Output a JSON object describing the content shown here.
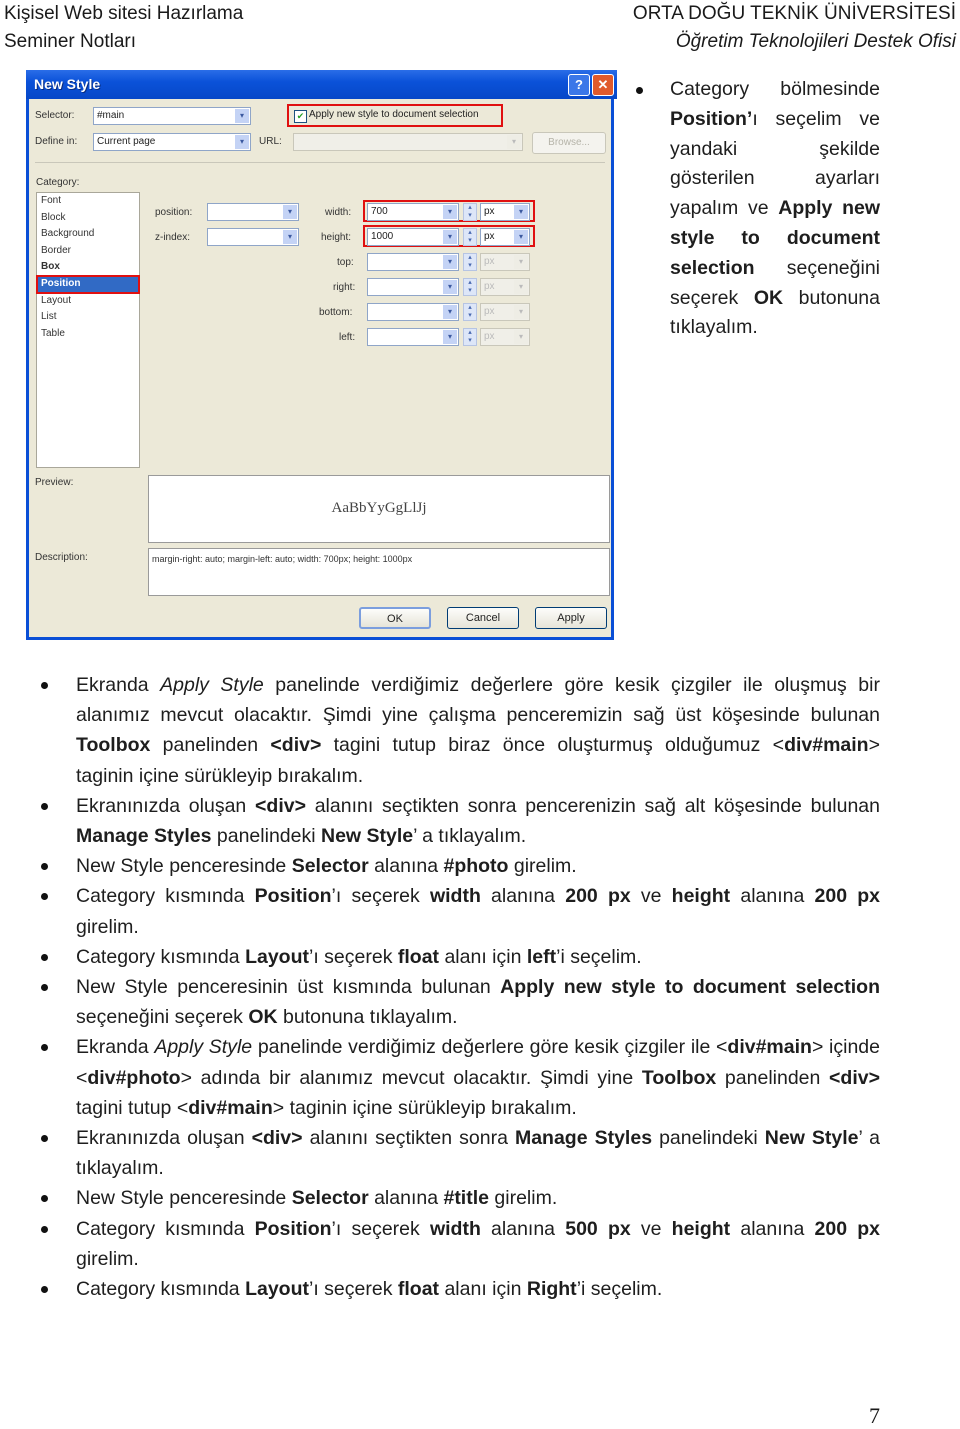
{
  "header": {
    "left_line1": "Kişisel Web sitesi Hazırlama",
    "left_line2": "Seminer Notları",
    "right_line1": "ORTA DOĞU TEKNİK ÜNİVERSİTESİ",
    "right_line2": "Öğretim Teknolojileri Destek Ofisi"
  },
  "dialog": {
    "title": "New Style",
    "help_icon": "?",
    "close_icon": "✕",
    "selector_label": "Selector:",
    "selector_value": "#main",
    "define_in_label": "Define in:",
    "define_in_value": "Current page",
    "url_label": "URL:",
    "url_value": "",
    "apply_checkbox_label": "Apply new style to document selection",
    "apply_checkbox_checked": true,
    "browse_label": "Browse...",
    "category_label": "Category:",
    "categories": [
      {
        "label": "Font",
        "state": "normal"
      },
      {
        "label": "Block",
        "state": "normal"
      },
      {
        "label": "Background",
        "state": "normal"
      },
      {
        "label": "Border",
        "state": "normal"
      },
      {
        "label": "Box",
        "state": "bold"
      },
      {
        "label": "Position",
        "state": "selected"
      },
      {
        "label": "Layout",
        "state": "normal"
      },
      {
        "label": "List",
        "state": "normal"
      },
      {
        "label": "Table",
        "state": "normal"
      }
    ],
    "position_label": "position:",
    "position_value": "",
    "zindex_label": "z-index:",
    "zindex_value": "",
    "width_label": "width:",
    "width_value": "700",
    "width_unit": "px",
    "height_label": "height:",
    "height_value": "1000",
    "height_unit": "px",
    "top_label": "top:",
    "right_label": "right:",
    "bottom_label": "bottom:",
    "left_label": "left:",
    "disabled_unit": "px",
    "preview_label": "Preview:",
    "preview_text": "AaBbYyGgLlJj",
    "description_label": "Description:",
    "description_text": "margin-right: auto; margin-left: auto; width: 700px; height: 1000px",
    "ok_label": "OK",
    "cancel_label": "Cancel",
    "apply_label": "Apply"
  },
  "side_note": {
    "parts": [
      {
        "t": "Category bölmesinde ",
        "b": false
      },
      {
        "t": "Position’",
        "b": true
      },
      {
        "t": "ı seçelim ve yandaki şekilde gösterilen ayarları yapalım ve ",
        "b": false
      },
      {
        "t": "Apply new style to document selection",
        "b": true
      },
      {
        "t": " seçeneğini seçerek ",
        "b": false
      },
      {
        "t": "OK",
        "b": true
      },
      {
        "t": " butonuna tıklayalım.",
        "b": false
      }
    ]
  },
  "bullets": [
    [
      {
        "t": "Ekranda "
      },
      {
        "t": "Apply Style",
        "i": true
      },
      {
        "t": " panelinde verdiğimiz değerlere göre kesik çizgiler ile oluşmuş bir alanımız mevcut olacaktır. Şimdi yine çalışma penceremizin sağ üst köşesinde bulunan "
      },
      {
        "t": "Toolbox",
        "b": true
      },
      {
        "t": " panelinden "
      },
      {
        "t": "<div>",
        "b": true
      },
      {
        "t": " tagini tutup biraz önce oluşturmuş olduğumuz <"
      },
      {
        "t": "div#main",
        "b": true
      },
      {
        "t": "> taginin içine sürükleyip bırakalım."
      }
    ],
    [
      {
        "t": "Ekranınızda oluşan "
      },
      {
        "t": "<div>",
        "b": true
      },
      {
        "t": " alanını seçtikten sonra pencerenizin sağ alt köşesinde bulunan "
      },
      {
        "t": "Manage Styles",
        "b": true
      },
      {
        "t": " panelindeki "
      },
      {
        "t": "New Style",
        "b": true
      },
      {
        "t": "’ a tıklayalım."
      }
    ],
    [
      {
        "t": "New Style penceresinde "
      },
      {
        "t": "Selector",
        "b": true
      },
      {
        "t": " alanına "
      },
      {
        "t": "#photo",
        "b": true
      },
      {
        "t": " girelim."
      }
    ],
    [
      {
        "t": "Category kısmında "
      },
      {
        "t": "Position",
        "b": true
      },
      {
        "t": "’ı seçerek "
      },
      {
        "t": "width",
        "b": true
      },
      {
        "t": " alanına "
      },
      {
        "t": "200 px",
        "b": true
      },
      {
        "t": " ve "
      },
      {
        "t": "height",
        "b": true
      },
      {
        "t": " alanına "
      },
      {
        "t": "200 px",
        "b": true
      },
      {
        "t": " girelim."
      }
    ],
    [
      {
        "t": "Category kısmında "
      },
      {
        "t": "Layout",
        "b": true
      },
      {
        "t": "’ı seçerek "
      },
      {
        "t": "float",
        "b": true
      },
      {
        "t": " alanı için "
      },
      {
        "t": "left",
        "b": true
      },
      {
        "t": "’i seçelim."
      }
    ],
    [
      {
        "t": "New Style penceresinin üst kısmında bulunan "
      },
      {
        "t": "Apply new style to document selection",
        "b": true
      },
      {
        "t": " seçeneğini seçerek "
      },
      {
        "t": "OK",
        "b": true
      },
      {
        "t": " butonuna tıklayalım."
      }
    ],
    [
      {
        "t": "Ekranda "
      },
      {
        "t": "Apply Style",
        "i": true
      },
      {
        "t": " panelinde verdiğimiz değerlere göre kesik çizgiler ile <"
      },
      {
        "t": "div#main",
        "b": true
      },
      {
        "t": "> içinde <"
      },
      {
        "t": "div#photo",
        "b": true
      },
      {
        "t": "> adında bir alanımız mevcut olacaktır. Şimdi yine "
      },
      {
        "t": "Toolbox",
        "b": true
      },
      {
        "t": " panelinden "
      },
      {
        "t": "<div>",
        "b": true
      },
      {
        "t": " tagini tutup <"
      },
      {
        "t": "div#main",
        "b": true
      },
      {
        "t": "> taginin içine sürükleyip bırakalım."
      }
    ],
    [
      {
        "t": "Ekranınızda oluşan "
      },
      {
        "t": "<div>",
        "b": true
      },
      {
        "t": " alanını seçtikten sonra "
      },
      {
        "t": "Manage Styles",
        "b": true
      },
      {
        "t": " panelindeki "
      },
      {
        "t": "New Style",
        "b": true
      },
      {
        "t": "’ a tıklayalım."
      }
    ],
    [
      {
        "t": "New Style penceresinde "
      },
      {
        "t": "Selector",
        "b": true
      },
      {
        "t": " alanına "
      },
      {
        "t": "#title",
        "b": true
      },
      {
        "t": " girelim."
      }
    ],
    [
      {
        "t": "Category kısmında "
      },
      {
        "t": "Position",
        "b": true
      },
      {
        "t": "’ı seçerek "
      },
      {
        "t": "width",
        "b": true
      },
      {
        "t": " alanına "
      },
      {
        "t": "500 px",
        "b": true
      },
      {
        "t": " ve "
      },
      {
        "t": "height",
        "b": true
      },
      {
        "t": " alanına "
      },
      {
        "t": "200 px",
        "b": true
      },
      {
        "t": " girelim."
      }
    ],
    [
      {
        "t": "Category kısmında "
      },
      {
        "t": "Layout",
        "b": true
      },
      {
        "t": "’ı seçerek "
      },
      {
        "t": "float",
        "b": true
      },
      {
        "t": " alanı için "
      },
      {
        "t": "Right",
        "b": true
      },
      {
        "t": "’i seçelim."
      }
    ]
  ],
  "page_number": "7"
}
